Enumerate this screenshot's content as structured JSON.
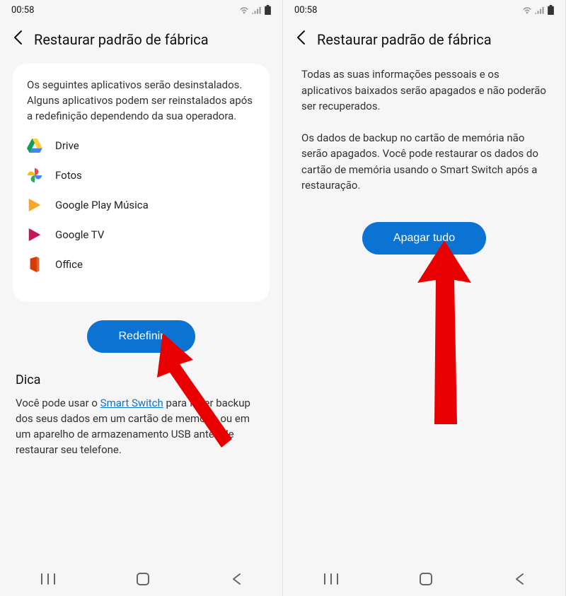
{
  "status": {
    "time": "00:58"
  },
  "header": {
    "title": "Restaurar padrão de fábrica"
  },
  "left": {
    "desc": "Os seguintes aplicativos serão desinstalados. Alguns aplicativos podem ser reinstalados após a redefinição dependendo da sua operadora.",
    "apps": [
      {
        "label": "Drive"
      },
      {
        "label": "Fotos"
      },
      {
        "label": "Google Play Música"
      },
      {
        "label": "Google TV"
      },
      {
        "label": "Office"
      }
    ],
    "button": "Redefinir",
    "tipTitle": "Dica",
    "tipPrefix": "Você pode usar o ",
    "tipLink": "Smart Switch",
    "tipSuffix": " para fazer backup dos seus dados em um cartão de memória ou em um aparelho de armazenamento USB antes de restaurar seu telefone."
  },
  "right": {
    "p1": "Todas as suas informações pessoais e os aplicativos baixados serão apagados e não poderão ser recuperados.",
    "p2": "Os dados de backup no cartão de memória não serão apagados. Você pode restaurar os dados do cartão de memória usando o Smart Switch após a restauração.",
    "button": "Apagar tudo"
  }
}
